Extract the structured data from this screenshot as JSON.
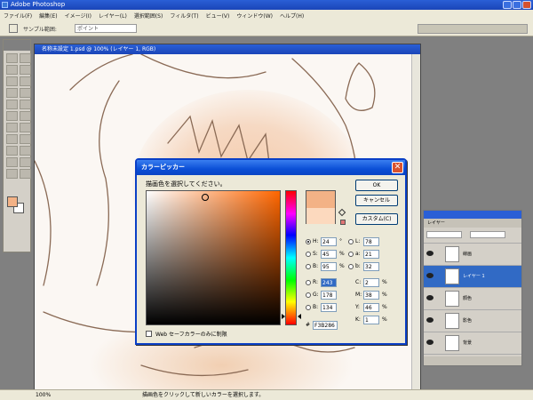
{
  "app": {
    "title": "Adobe Photoshop"
  },
  "menu": [
    "ファイル(F)",
    "編集(E)",
    "イメージ(I)",
    "レイヤー(L)",
    "選択範囲(S)",
    "フィルタ(T)",
    "ビュー(V)",
    "ウィンドウ(W)",
    "ヘルプ(H)"
  ],
  "options_bar": {
    "label": "サンプル範囲:",
    "select_value": "ポイント"
  },
  "document": {
    "title": "名称未設定 1.psd @ 100% (レイヤー 1, RGB)"
  },
  "status": {
    "zoom": "100%",
    "hint": "描画色をクリックして新しいカラーを選択します。"
  },
  "layers_panel": {
    "tabs": "レイヤー",
    "layers": [
      {
        "name": "線画",
        "active": false
      },
      {
        "name": "レイヤー 1",
        "active": true
      },
      {
        "name": "顔色",
        "active": false
      },
      {
        "name": "影色",
        "active": false
      },
      {
        "name": "背景",
        "active": false
      }
    ]
  },
  "color_picker": {
    "title": "カラーピッカー",
    "prompt": "描画色を選択してください。",
    "ok": "OK",
    "cancel": "キャンセル",
    "custom": "カスタム(C)",
    "web_safe": "Web セーフカラーのみに制限",
    "hex_label": "#",
    "hex": "F3B286",
    "new_color": "#f3b286",
    "current_color": "#fcd9be",
    "hsb": [
      {
        "k": "H:",
        "v": "24",
        "u": "°",
        "on": true
      },
      {
        "k": "S:",
        "v": "45",
        "u": "%",
        "on": false
      },
      {
        "k": "B:",
        "v": "95",
        "u": "%",
        "on": false
      }
    ],
    "rgb": [
      {
        "k": "R:",
        "v": "243",
        "on": false
      },
      {
        "k": "G:",
        "v": "178",
        "on": false
      },
      {
        "k": "B:",
        "v": "134",
        "on": false
      }
    ],
    "lab": [
      {
        "k": "L:",
        "v": "78",
        "on": false
      },
      {
        "k": "a:",
        "v": "21",
        "on": false
      },
      {
        "k": "b:",
        "v": "32",
        "on": false
      }
    ],
    "cmyk": [
      {
        "k": "C:",
        "v": "2",
        "u": "%"
      },
      {
        "k": "M:",
        "v": "38",
        "u": "%"
      },
      {
        "k": "Y:",
        "v": "46",
        "u": "%"
      },
      {
        "k": "K:",
        "v": "1",
        "u": "%"
      }
    ]
  }
}
